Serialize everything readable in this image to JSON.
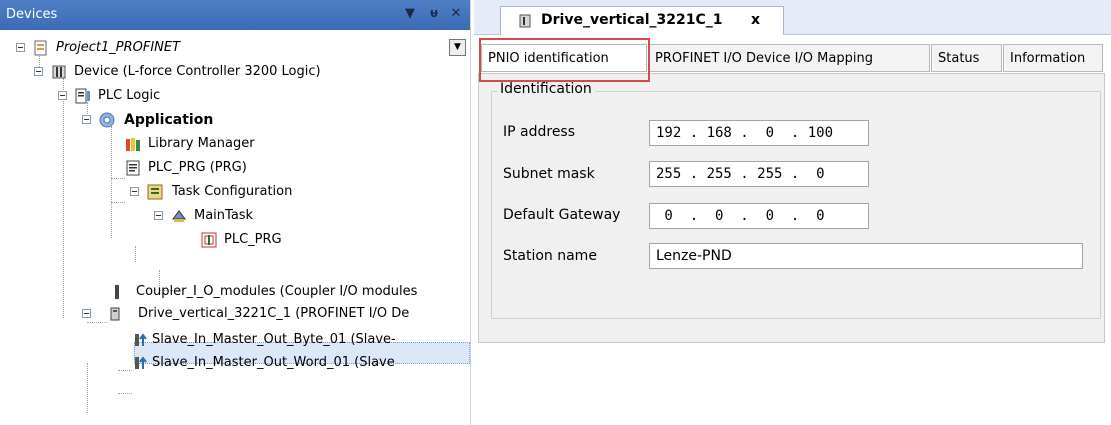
{
  "devices_panel": {
    "title": "Devices",
    "menu_glyph": "▼",
    "pin_glyph": "ᵾ",
    "close_glyph": "✕",
    "dropdown_glyph": "▼",
    "tree": [
      {
        "label": "Project1_PROFINET",
        "icon": "project-icon"
      },
      {
        "label": "Device (L-force Controller 3200 Logic)",
        "icon": "device-icon"
      },
      {
        "label": "PLC Logic",
        "icon": "plc-logic-icon"
      },
      {
        "label": "Application",
        "icon": "application-gear-icon"
      },
      {
        "label": "Library Manager",
        "icon": "library-books-icon"
      },
      {
        "label": "PLC_PRG (PRG)",
        "icon": "program-document-icon"
      },
      {
        "label": "Task Configuration",
        "icon": "task-configuration-icon"
      },
      {
        "label": "MainTask",
        "icon": "main-task-icon"
      },
      {
        "label": "PLC_PRG",
        "icon": "program-call-icon"
      },
      {
        "label": "Coupler_I_O_modules (Coupler I/O modules",
        "icon": "coupler-icon"
      },
      {
        "label": "Drive_vertical_3221C_1 (PROFINET I/O De",
        "icon": "drive-device-icon"
      },
      {
        "label": "Slave_In_Master_Out_Byte_01 (Slave-",
        "icon": "io-module-icon"
      },
      {
        "label": "Slave_In_Master_Out_Word_01 (Slave",
        "icon": "io-module-icon"
      }
    ]
  },
  "editor": {
    "doc_tab": {
      "label": "Drive_vertical_3221C_1",
      "close": "x",
      "icon": "device-tab-icon"
    },
    "tabs": [
      "PNIO identification",
      "PROFINET I/O Device I/O Mapping",
      "Status",
      "Information"
    ],
    "active_tab": "PNIO identification",
    "group_title": "Identification",
    "fields": {
      "ip": {
        "label": "IP address",
        "value": "192 . 168 .  0  . 100"
      },
      "subnet": {
        "label": "Subnet mask",
        "value": "255 . 255 . 255 .  0"
      },
      "gateway": {
        "label": "Default Gateway",
        "value": " 0  .  0  .  0  .  0"
      },
      "station": {
        "label": "Station name",
        "value": "Lenze-PND"
      }
    }
  },
  "colors": {
    "panel_header": "#3d6bb3",
    "highlight": "#d84a4a",
    "selection": "#dce8f7"
  }
}
